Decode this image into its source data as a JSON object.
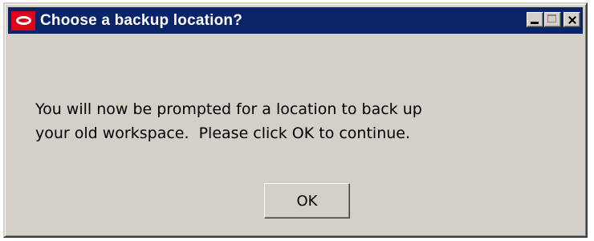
{
  "dialog": {
    "title": "Choose a backup location?",
    "message_lines": [
      "You will now be prompted for a location to back up",
      "your old workspace.  Please click OK to continue."
    ],
    "ok_label": "OK"
  },
  "icons": {
    "app": "oracle-logo-icon",
    "minimize": "minimize-icon",
    "maximize": "maximize-icon",
    "close": "close-icon"
  },
  "colors": {
    "titlebar": "#0a246a",
    "logo": "#e2001a",
    "dialog_face": "#d4d0c8"
  }
}
